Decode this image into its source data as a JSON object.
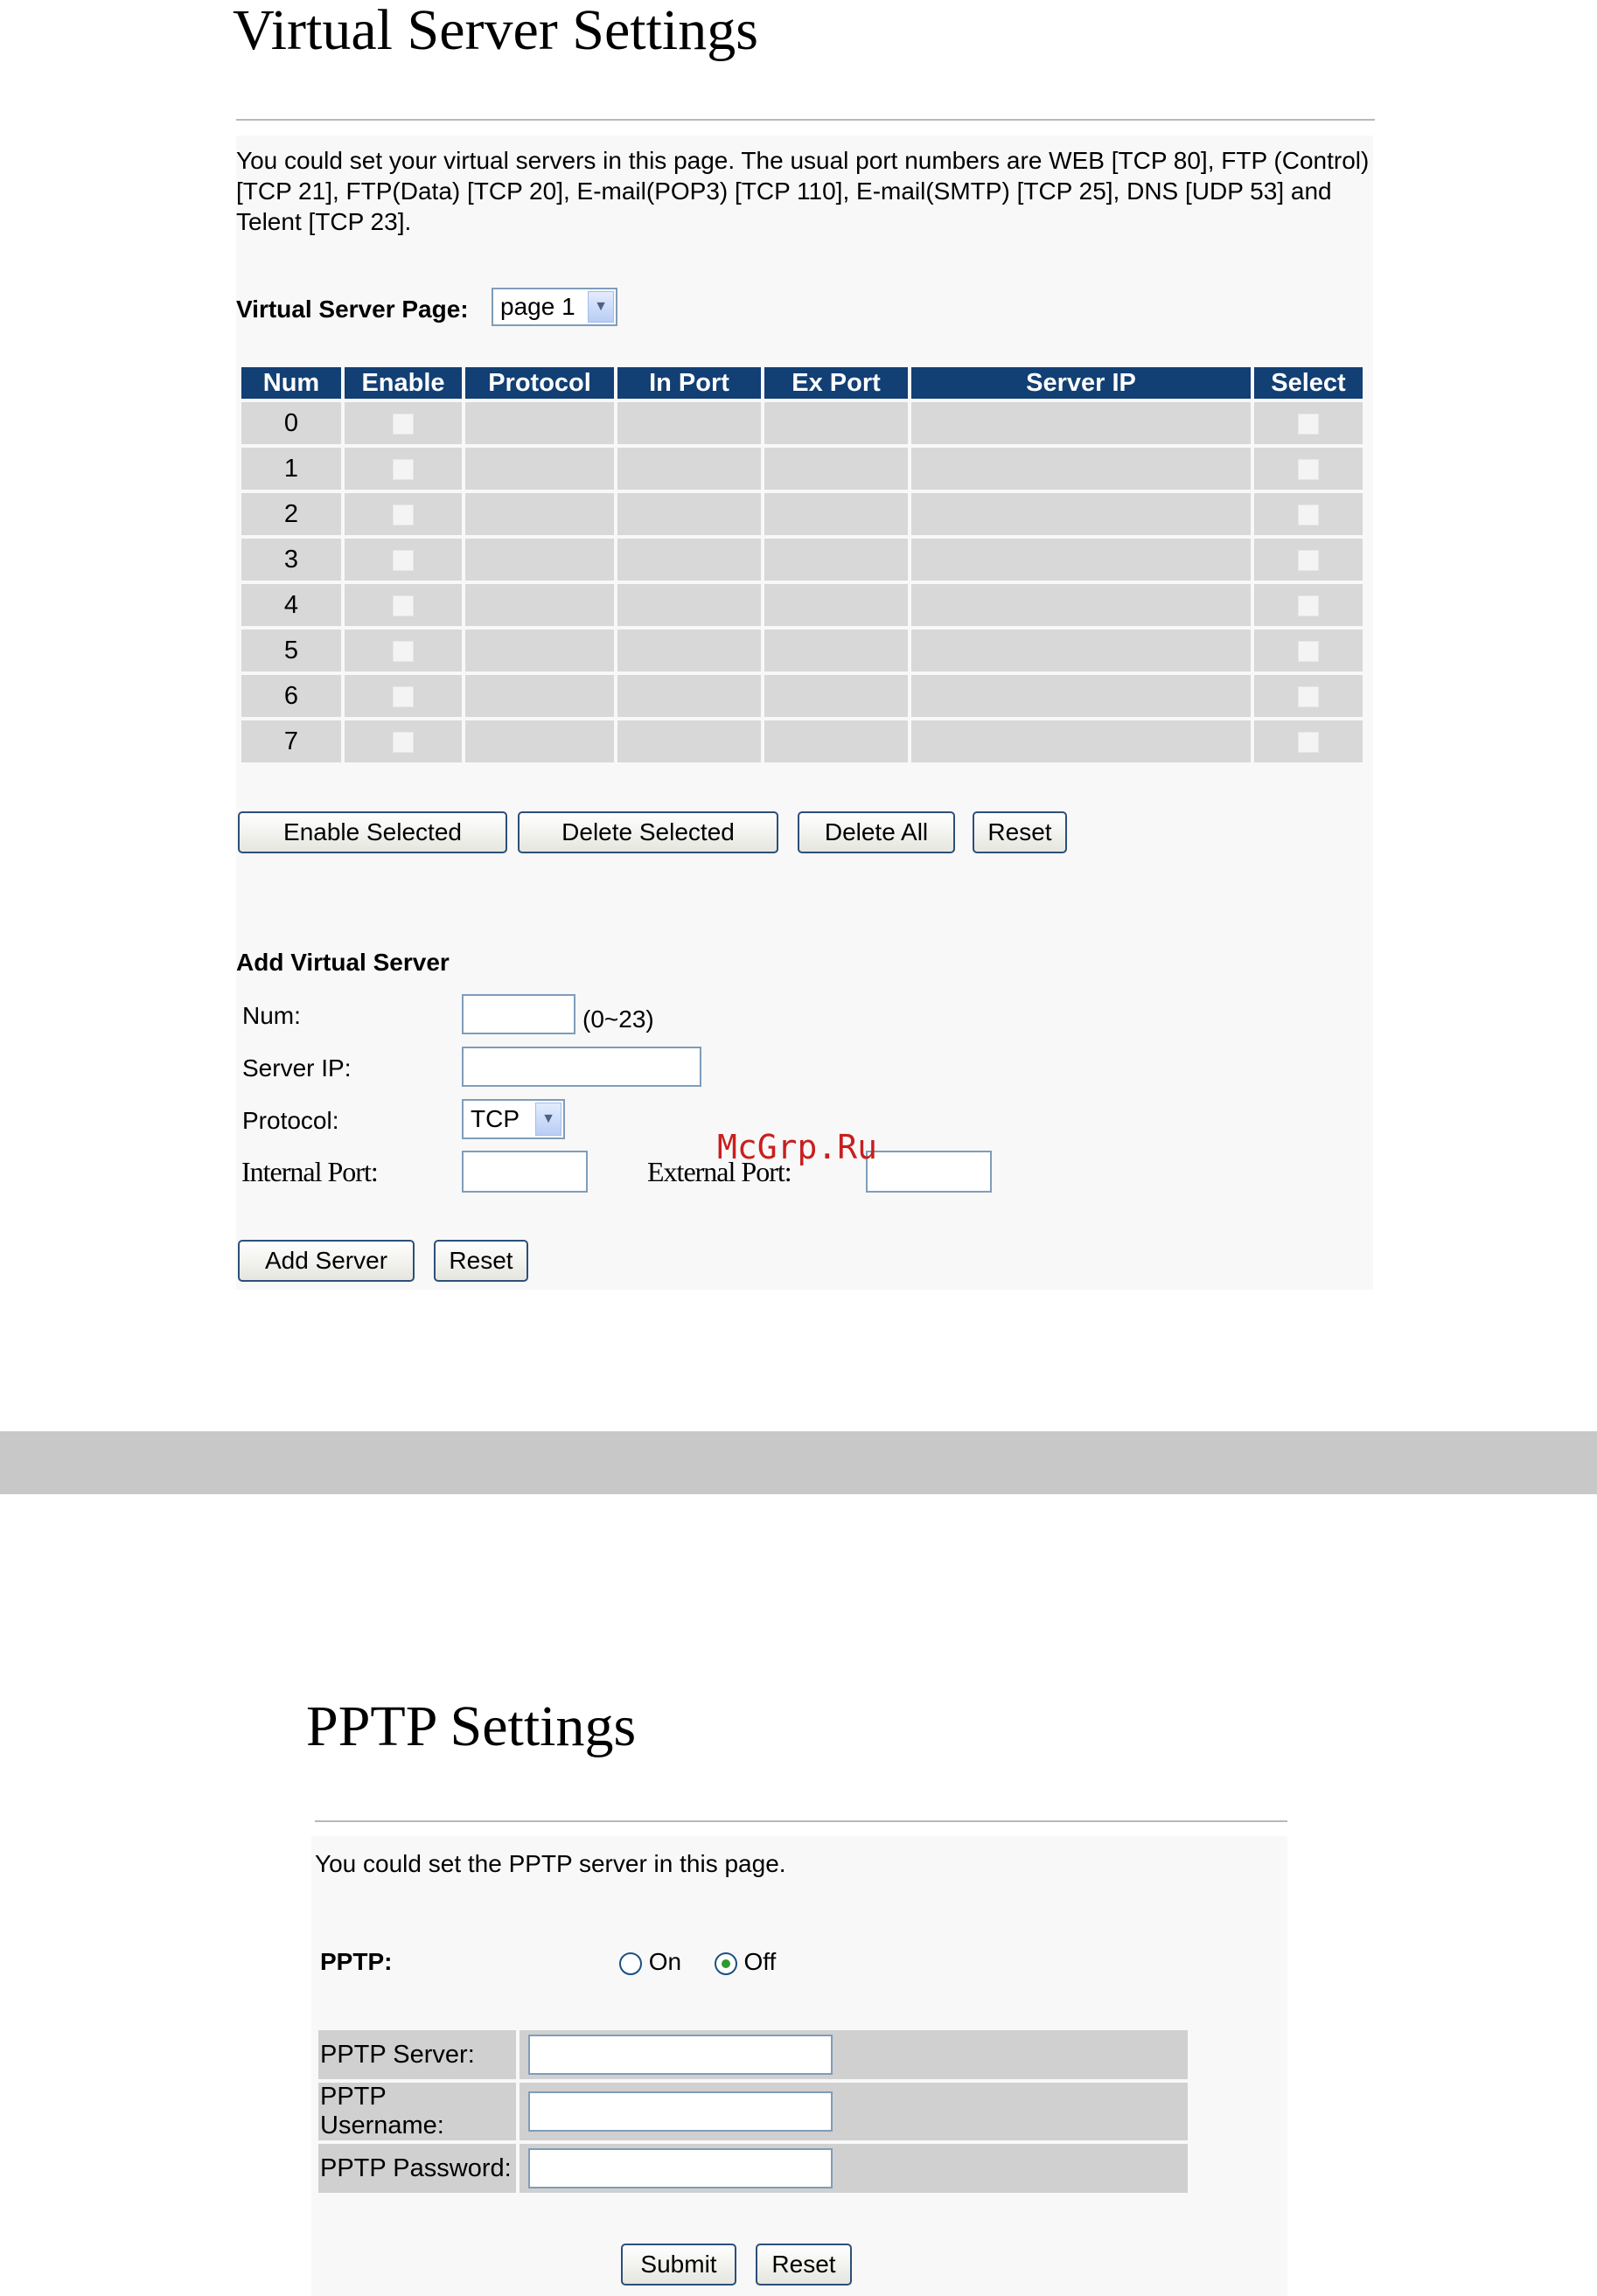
{
  "virtual_server": {
    "title": "Virtual Server Settings",
    "description": "You could set your virtual servers in this page. The usual port numbers are WEB [TCP 80], FTP (Control) [TCP 21], FTP(Data) [TCP 20], E-mail(POP3) [TCP 110], E-mail(SMTP) [TCP 25], DNS [UDP 53] and Telent [TCP 23].",
    "page_label": "Virtual Server Page:",
    "page_select_value": "page 1",
    "table": {
      "headers": [
        "Num",
        "Enable",
        "Protocol",
        "In Port",
        "Ex Port",
        "Server IP",
        "Select"
      ],
      "rows": [
        {
          "num": "0"
        },
        {
          "num": "1"
        },
        {
          "num": "2"
        },
        {
          "num": "3"
        },
        {
          "num": "4"
        },
        {
          "num": "5"
        },
        {
          "num": "6"
        },
        {
          "num": "7"
        }
      ]
    },
    "buttons": {
      "enable_selected": "Enable Selected",
      "delete_selected": "Delete Selected",
      "delete_all": "Delete All",
      "reset": "Reset"
    },
    "add": {
      "heading": "Add Virtual Server",
      "num_label": "Num:",
      "num_value": "",
      "num_hint": "(0~23)",
      "server_ip_label": "Server IP:",
      "server_ip_value": "",
      "protocol_label": "Protocol:",
      "protocol_value": "TCP",
      "internal_port_label": "Internal Port:",
      "internal_port_value": "",
      "external_port_label": "External Port:",
      "external_port_value": "",
      "add_button": "Add Server",
      "reset_button": "Reset"
    }
  },
  "watermark": "McGrp.Ru",
  "pptp": {
    "title": "PPTP Settings",
    "description": "You could set the PPTP server in this page.",
    "pptp_label": "PPTP:",
    "option_on": "On",
    "option_off": "Off",
    "selected": "Off",
    "server_label": "PPTP Server:",
    "server_value": "",
    "username_label": "PPTP Username:",
    "username_value": "",
    "password_label": "PPTP Password:",
    "password_value": "",
    "submit_button": "Submit",
    "reset_button": "Reset"
  }
}
